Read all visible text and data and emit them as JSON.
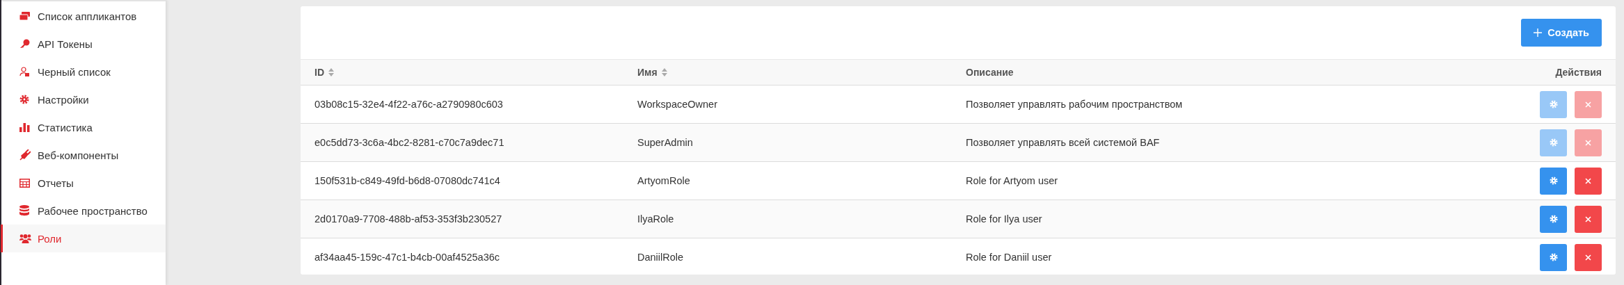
{
  "sidebar": {
    "items": [
      {
        "label": "Список аппликантов",
        "selected": false
      },
      {
        "label": "API Токены",
        "selected": false
      },
      {
        "label": "Черный список",
        "selected": false
      },
      {
        "label": "Настройки",
        "selected": false
      },
      {
        "label": "Статистика",
        "selected": false
      },
      {
        "label": "Веб-компоненты",
        "selected": false
      },
      {
        "label": "Отчеты",
        "selected": false
      },
      {
        "label": "Рабочее пространство",
        "selected": false
      },
      {
        "label": "Роли",
        "selected": true
      }
    ]
  },
  "create_button": {
    "label": "Создать"
  },
  "table": {
    "columns": [
      {
        "label": "ID",
        "sortable": true
      },
      {
        "label": "Имя",
        "sortable": true
      },
      {
        "label": "Описание",
        "sortable": false
      },
      {
        "label": "Действия",
        "sortable": false
      }
    ],
    "rows": [
      {
        "id": "03b08c15-32e4-4f22-a76c-a2790980c603",
        "name": "WorkspaceOwner",
        "description": "Позволяет управлять рабочим пространством",
        "disabled": true
      },
      {
        "id": "e0c5dd73-3c6a-4bc2-8281-c70c7a9dec71",
        "name": "SuperAdmin",
        "description": "Позволяет управлять всей системой BAF",
        "disabled": true
      },
      {
        "id": "150f531b-c849-49fd-b6d8-07080dc741c4",
        "name": "ArtyomRole",
        "description": "Role for Artyom user",
        "disabled": false
      },
      {
        "id": "2d0170a9-7708-488b-af53-353f3b230527",
        "name": "IlyaRole",
        "description": "Role for Ilya user",
        "disabled": false
      },
      {
        "id": "af34aa45-159c-47c1-b4cb-00af4525a36c",
        "name": "DaniilRole",
        "description": "Role for Daniil user",
        "disabled": false
      }
    ]
  }
}
